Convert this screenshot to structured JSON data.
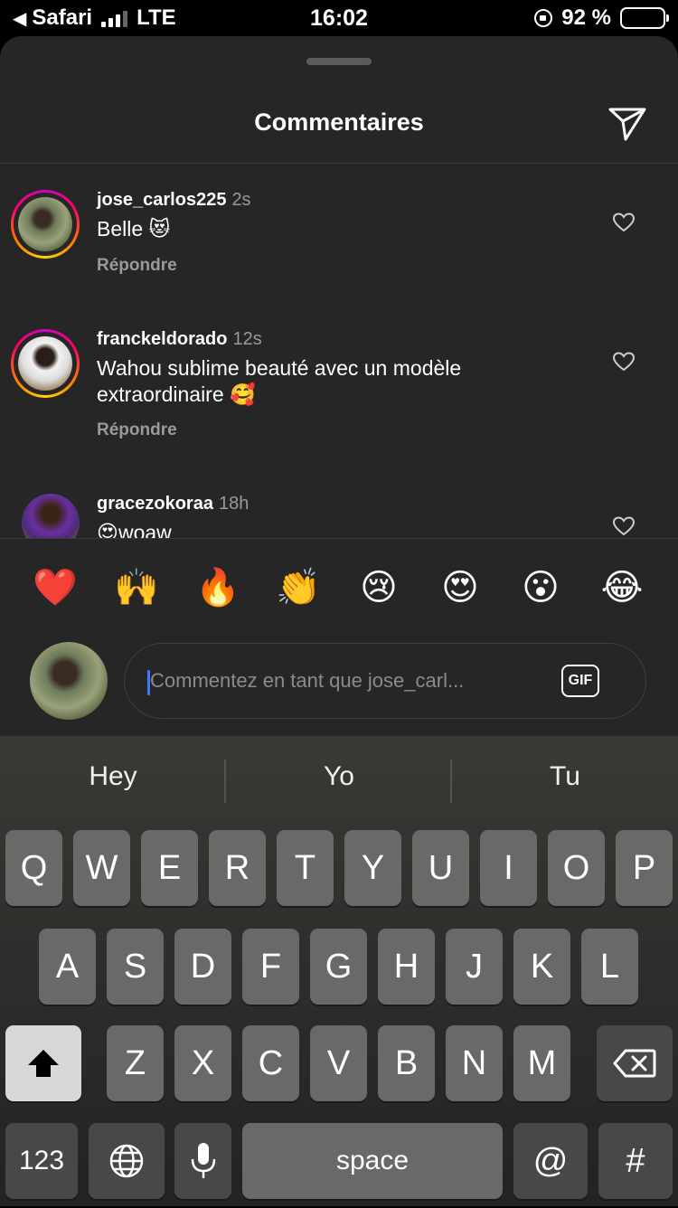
{
  "status_bar": {
    "back_app": "Safari",
    "network": "LTE",
    "time": "16:02",
    "battery_text": "92 %",
    "battery_level": 0.92
  },
  "sheet": {
    "title": "Commentaires",
    "send_icon": "paper-plane-icon"
  },
  "comments": [
    {
      "username": "jose_carlos225",
      "time": "2s",
      "text": "Belle 😻",
      "reply_label": "Répondre",
      "story_ring": true
    },
    {
      "username": "franckeldorado",
      "time": "12s",
      "text": "Wahou sublime beauté avec un modèle extraordinaire 🥰",
      "reply_label": "Répondre",
      "story_ring": true
    },
    {
      "username": "gracezokoraa",
      "time": "18h",
      "text": "😍woaw",
      "story_ring": false
    }
  ],
  "quick_reactions": [
    "❤️",
    "🙌",
    "🔥",
    "👏",
    "😢",
    "😍",
    "😮",
    "😂"
  ],
  "composer": {
    "placeholder": "Commentez en tant que jose_carl...",
    "gif_label": "GIF"
  },
  "keyboard": {
    "suggestions": [
      "Hey",
      "Yo",
      "Tu"
    ],
    "row1": [
      "Q",
      "W",
      "E",
      "R",
      "T",
      "Y",
      "U",
      "I",
      "O",
      "P"
    ],
    "row2": [
      "A",
      "S",
      "D",
      "F",
      "G",
      "H",
      "J",
      "K",
      "L"
    ],
    "row3": [
      "Z",
      "X",
      "C",
      "V",
      "B",
      "N",
      "M"
    ],
    "numbers_key": "123",
    "space_key": "space",
    "at_key": "@",
    "hash_key": "#"
  },
  "colors": {
    "sheet_bg": "#262626",
    "caret": "#3a7bff",
    "muted_text": "#9a9a9a"
  }
}
